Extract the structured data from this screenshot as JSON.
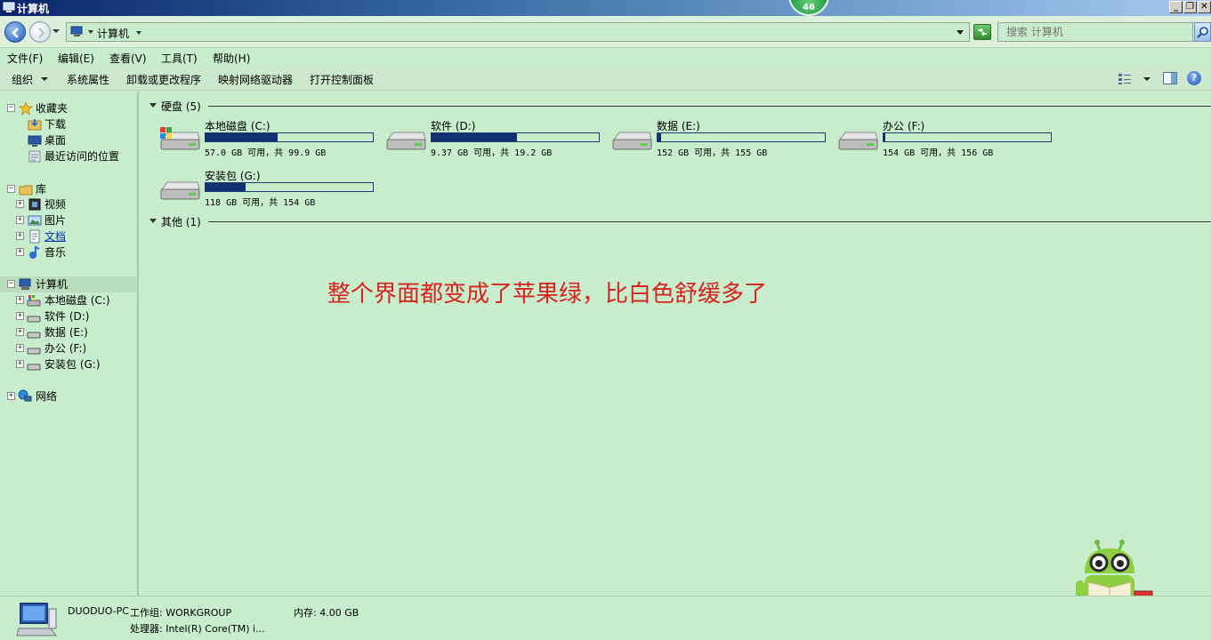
{
  "window": {
    "title": "计算机",
    "badge": "46",
    "controls": [
      "_",
      "❐",
      "✕"
    ]
  },
  "address": {
    "crumb": "计算机",
    "search_placeholder": "搜索 计算机"
  },
  "menu": {
    "items": [
      "文件(F)",
      "编辑(E)",
      "查看(V)",
      "工具(T)",
      "帮助(H)"
    ]
  },
  "commands": {
    "organize": "组织",
    "system_properties": "系统属性",
    "uninstall": "卸载或更改程序",
    "map_drive": "映射网络驱动器",
    "control_panel": "打开控制面板"
  },
  "nav": {
    "favorites": "收藏夹",
    "downloads": "下载",
    "desktop": "桌面",
    "recent": "最近访问的位置",
    "libraries": "库",
    "videos": "视频",
    "pictures": "图片",
    "documents": "文档",
    "music": "音乐",
    "computer": "计算机",
    "drives": [
      "本地磁盘 (C:)",
      "软件 (D:)",
      "数据 (E:)",
      "办公 (F:)",
      "安装包 (G:)"
    ],
    "network": "网络"
  },
  "groups": {
    "hard_disks": "硬盘 (5)",
    "other": "其他 (1)"
  },
  "drives": [
    {
      "name": "本地磁盘 (C:)",
      "free": "57.0 GB 可用，共 99.9 GB",
      "used_fraction": 0.43,
      "system": true
    },
    {
      "name": "软件 (D:)",
      "free": "9.37 GB 可用，共 19.2 GB",
      "used_fraction": 0.51,
      "system": false
    },
    {
      "name": "数据 (E:)",
      "free": "152 GB 可用，共 155 GB",
      "used_fraction": 0.02,
      "system": false
    },
    {
      "name": "办公 (F:)",
      "free": "154 GB 可用，共 156 GB",
      "used_fraction": 0.01,
      "system": false
    },
    {
      "name": "安装包 (G:)",
      "free": "118 GB 可用，共 154 GB",
      "used_fraction": 0.24,
      "system": false
    }
  ],
  "annotation": "整个界面都变成了苹果绿，比白色舒缓多了",
  "details": {
    "pc_name": "DUODUO-PC",
    "workgroup": "工作组: WORKGROUP",
    "memory": "内存: 4.00 GB",
    "processor": "处理器: Intel(R) Core(TM) i..."
  },
  "colors": {
    "background": "#c7edcc",
    "bar_fill": "#10306f",
    "annotation": "#d6231f"
  }
}
